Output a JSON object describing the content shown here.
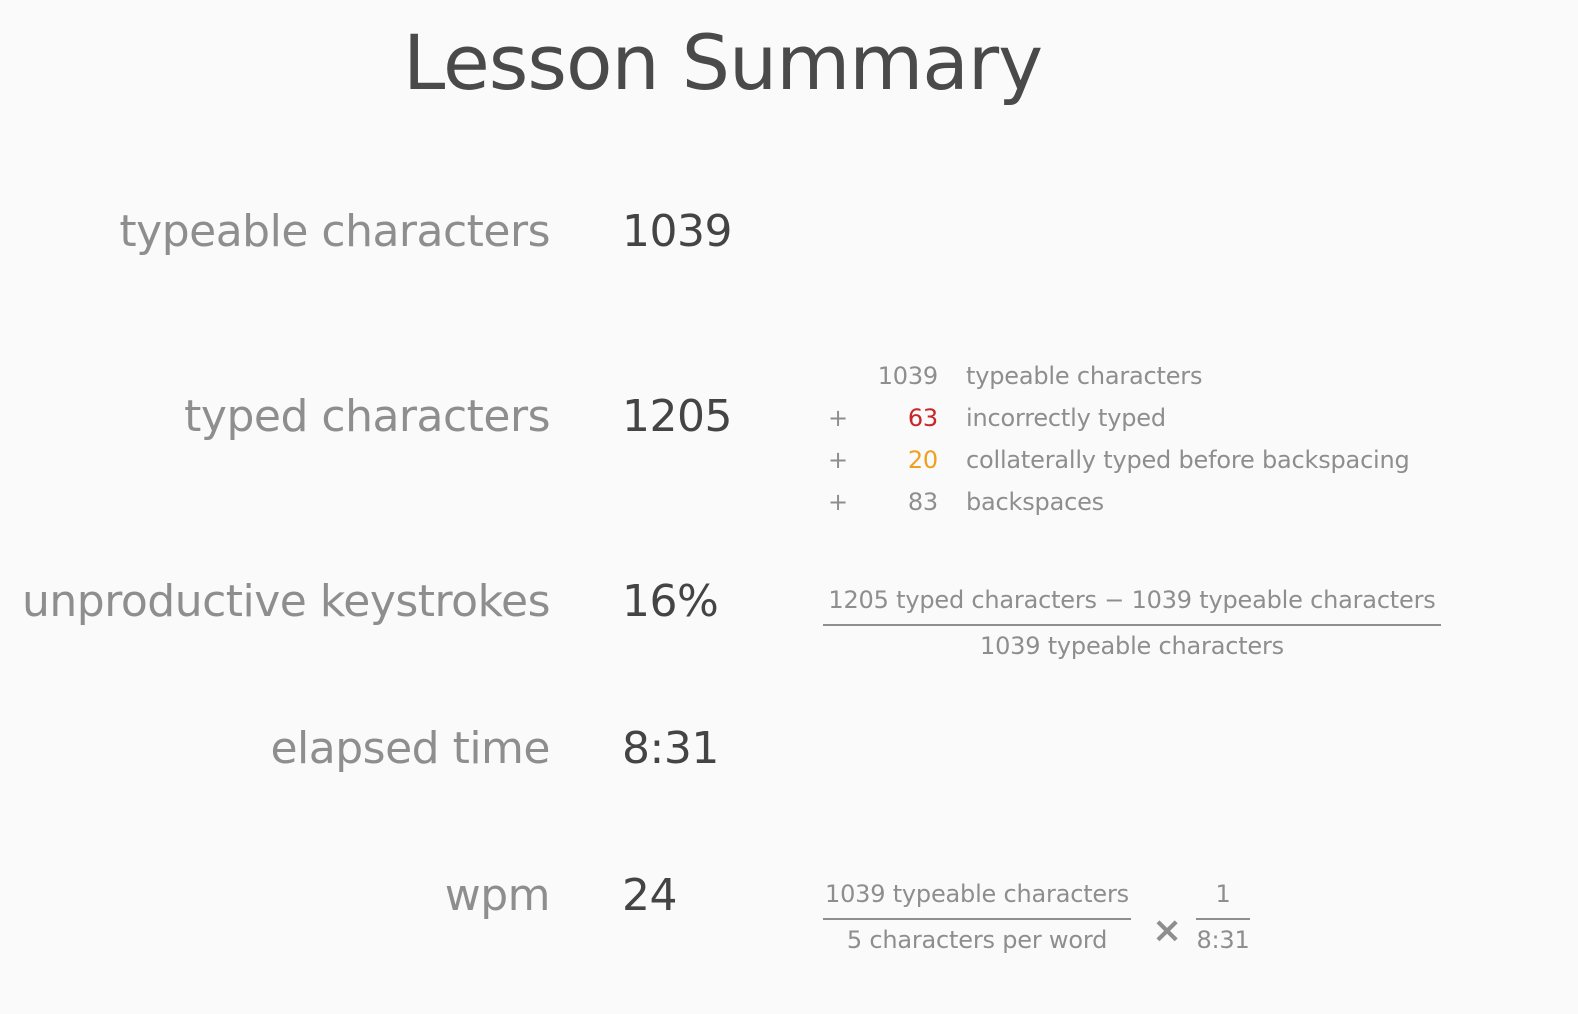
{
  "title": "Lesson Summary",
  "rows": [
    {
      "label": "typeable characters",
      "value": "1039"
    },
    {
      "label": "typed characters",
      "value": "1205"
    },
    {
      "label": "unproductive keystrokes",
      "value": "16%"
    },
    {
      "label": "elapsed time",
      "value": "8:31"
    },
    {
      "label": "wpm",
      "value": "24"
    }
  ],
  "typed_breakdown": [
    {
      "op": "",
      "num": "1039",
      "desc": "typeable characters",
      "color": "#8e8e8e"
    },
    {
      "op": "+",
      "num": "63",
      "desc": "incorrectly typed",
      "color": "#c8262b"
    },
    {
      "op": "+",
      "num": "20",
      "desc": "collaterally typed before backspacing",
      "color": "#f0a020"
    },
    {
      "op": "+",
      "num": "83",
      "desc": "backspaces",
      "color": "#8e8e8e"
    }
  ],
  "unproductive_formula": {
    "numerator": "1205 typed characters − 1039 typeable characters",
    "denominator": "1039 typeable characters"
  },
  "wpm_formula": {
    "numerator": "1039 typeable characters",
    "denominator": "5 characters per word",
    "times": "×",
    "num2": "1",
    "den2": "8:31"
  }
}
